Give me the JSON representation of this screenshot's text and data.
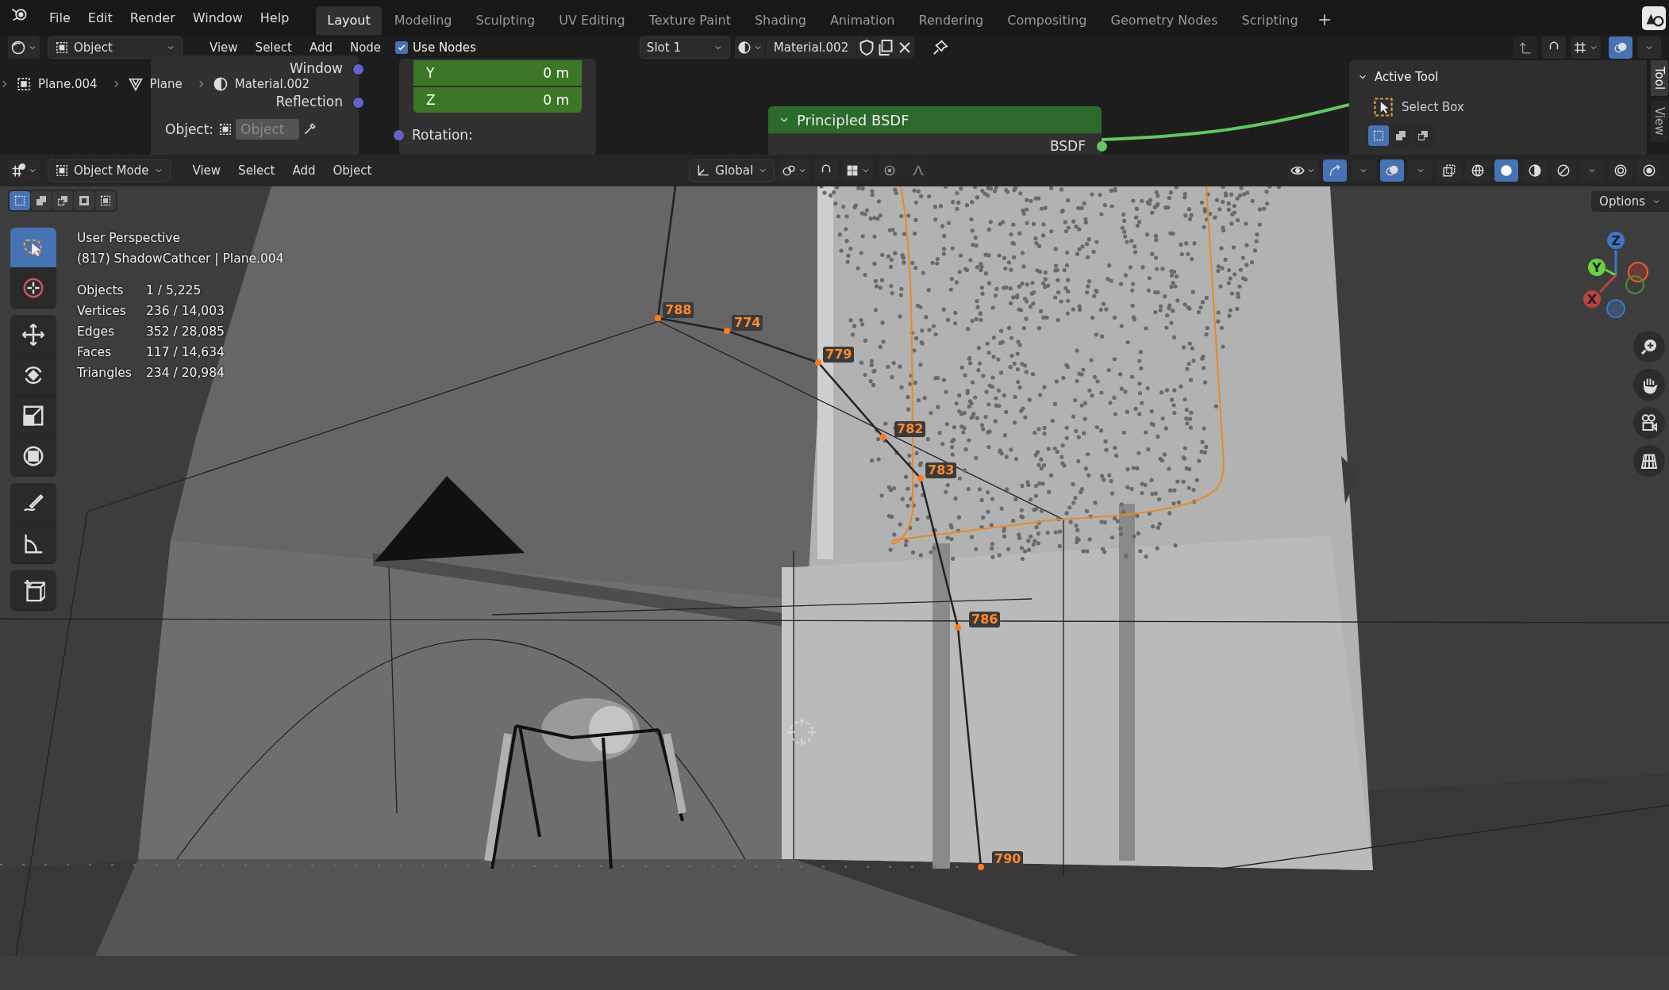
{
  "menu": [
    "File",
    "Edit",
    "Render",
    "Window",
    "Help"
  ],
  "workspaces": [
    {
      "label": "Layout",
      "selected": true
    },
    {
      "label": "Modeling",
      "selected": false
    },
    {
      "label": "Sculpting",
      "selected": false
    },
    {
      "label": "UV Editing",
      "selected": false
    },
    {
      "label": "Texture Paint",
      "selected": false
    },
    {
      "label": "Shading",
      "selected": false
    },
    {
      "label": "Animation",
      "selected": false
    },
    {
      "label": "Rendering",
      "selected": false
    },
    {
      "label": "Compositing",
      "selected": false
    },
    {
      "label": "Geometry Nodes",
      "selected": false
    },
    {
      "label": "Scripting",
      "selected": false
    }
  ],
  "node_editor": {
    "header": {
      "type_dropdown": "Object",
      "menus": [
        "View",
        "Select",
        "Add",
        "Node"
      ],
      "use_nodes": {
        "label": "Use Nodes",
        "checked": true
      },
      "slot": "Slot 1",
      "material": "Material.002"
    },
    "breadcrumbs": [
      "Plane.004",
      "Plane",
      "Material.002"
    ],
    "nodes": [
      {
        "kind": "sockets",
        "sockets": [
          "Window",
          "Reflection"
        ],
        "object_field": {
          "label": "Object:",
          "placeholder": "Object"
        }
      },
      {
        "kind": "vector",
        "rows": [
          {
            "axis": "Y",
            "value": "0 m"
          },
          {
            "axis": "Z",
            "value": "0 m"
          }
        ],
        "socket": "Rotation:"
      },
      {
        "kind": "shader",
        "title": "Principled BSDF",
        "output": "BSDF",
        "expanded": true
      }
    ],
    "sidebar": {
      "panel": {
        "title": "Active Tool",
        "expanded": true,
        "tool": "Select Box"
      },
      "select_modes": [
        {
          "selected": true
        },
        {
          "selected": false
        },
        {
          "selected": false
        }
      ],
      "tabs": [
        {
          "label": "Tool",
          "selected": true
        },
        {
          "label": "View",
          "selected": false
        }
      ]
    }
  },
  "viewport": {
    "header": {
      "mode": "Object Mode",
      "menus": [
        "View",
        "Select",
        "Add",
        "Object"
      ],
      "orientation": "Global",
      "options": "Options"
    },
    "select_modes": [
      {
        "selected": true
      },
      {
        "selected": false
      },
      {
        "selected": false
      },
      {
        "selected": false
      },
      {
        "selected": false
      }
    ],
    "tools": [
      {
        "selected": true
      },
      {
        "selected": false
      },
      {
        "selected": false
      },
      {
        "selected": false
      },
      {
        "selected": false
      },
      {
        "selected": false
      },
      {
        "selected": false
      },
      {
        "selected": false
      },
      {
        "selected": false
      }
    ],
    "overlay": {
      "view": "User Perspective",
      "object": "(817) ShadowCathcer | Plane.004",
      "stats": [
        {
          "label": "Objects",
          "value": "1 / 5,225"
        },
        {
          "label": "Vertices",
          "value": "236 / 14,003"
        },
        {
          "label": "Edges",
          "value": "352 / 28,085"
        },
        {
          "label": "Faces",
          "value": "117 / 14,634"
        },
        {
          "label": "Triangles",
          "value": "234 / 20,984"
        }
      ]
    },
    "gizmo_axes": [
      {
        "label": "Z",
        "color": "#3f76c6"
      },
      {
        "label": "Y",
        "color": "#6ad142"
      },
      {
        "label": "X",
        "color": "#b8443e"
      }
    ],
    "vertex_labels": [
      "788",
      "774",
      "779",
      "782",
      "783",
      "786",
      "790"
    ]
  }
}
